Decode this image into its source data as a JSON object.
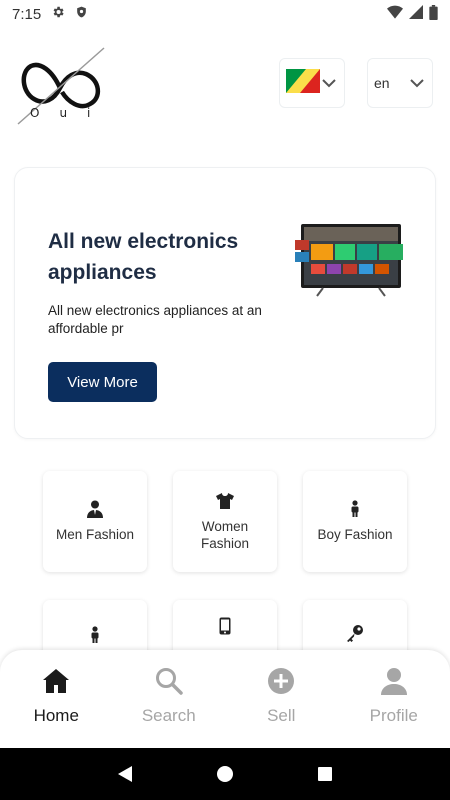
{
  "status_bar": {
    "time": "7:15"
  },
  "header": {
    "logo_text": "Oui",
    "language": "en"
  },
  "banner": {
    "title": "All new electronics appliances",
    "description": "All new electronics appliances at an affordable pr",
    "button_label": "View More"
  },
  "categories": [
    {
      "label": "Men Fashion",
      "icon": "man-icon"
    },
    {
      "label": "Women Fashion",
      "icon": "tshirt-icon"
    },
    {
      "label": "Boy Fashion",
      "icon": "child-icon"
    },
    {
      "label": "",
      "icon": "child-icon"
    },
    {
      "label": "",
      "icon": "phone-icon"
    },
    {
      "label": "",
      "icon": "key-icon"
    }
  ],
  "bottom_nav": {
    "items": [
      {
        "label": "Home",
        "icon": "home-icon",
        "active": true
      },
      {
        "label": "Search",
        "icon": "search-icon",
        "active": false
      },
      {
        "label": "Sell",
        "icon": "plus-circle-icon",
        "active": false
      },
      {
        "label": "Profile",
        "icon": "person-icon",
        "active": false
      }
    ]
  },
  "colors": {
    "primary": "#0b2e5e",
    "title": "#1f2d44",
    "nav_active": "#1b1b1b",
    "nav_inactive": "#a6a6a6"
  }
}
